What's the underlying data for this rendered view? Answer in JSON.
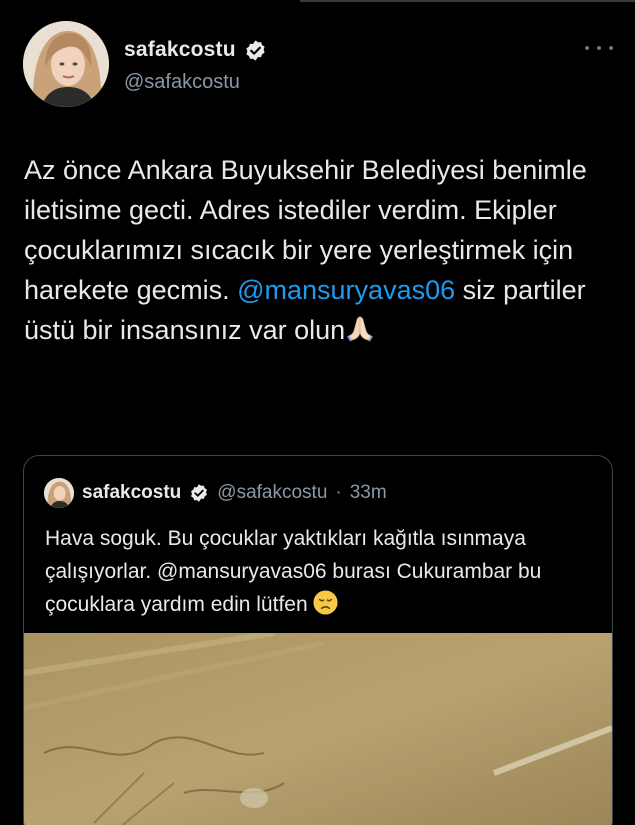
{
  "tweet": {
    "author": {
      "display_name": "safakcostu",
      "handle": "@safakcostu",
      "verified": true
    },
    "text_parts": {
      "before_mention": "Az önce Ankara Buyuksehir Belediyesi benimle iletisime gecti. Adres istediler verdim. Ekipler çocuklarımızı sıcacık bir yere yerleştirmek için harekete gecmis. ",
      "mention": "@mansuryavas06",
      "after_mention": " siz partiler üstü bir insansınız var olun"
    },
    "emoji": "folded-hands"
  },
  "quoted_tweet": {
    "author": {
      "display_name": "safakcostu",
      "handle": "@safakcostu",
      "time": "33m",
      "separator": "·",
      "verified": true
    },
    "text": "Hava soguk. Bu çocuklar yaktıkları kağıtla ısınmaya çalışıyorlar. @mansuryavas06 burası Cukurambar bu çocuklara yardım edin lütfen",
    "emoji": "disappointed-face"
  },
  "colors": {
    "background": "#000000",
    "text": "#e7e9ea",
    "secondary": "#8b98a5",
    "accent": "#1d9bf0",
    "border": "#38444d"
  }
}
